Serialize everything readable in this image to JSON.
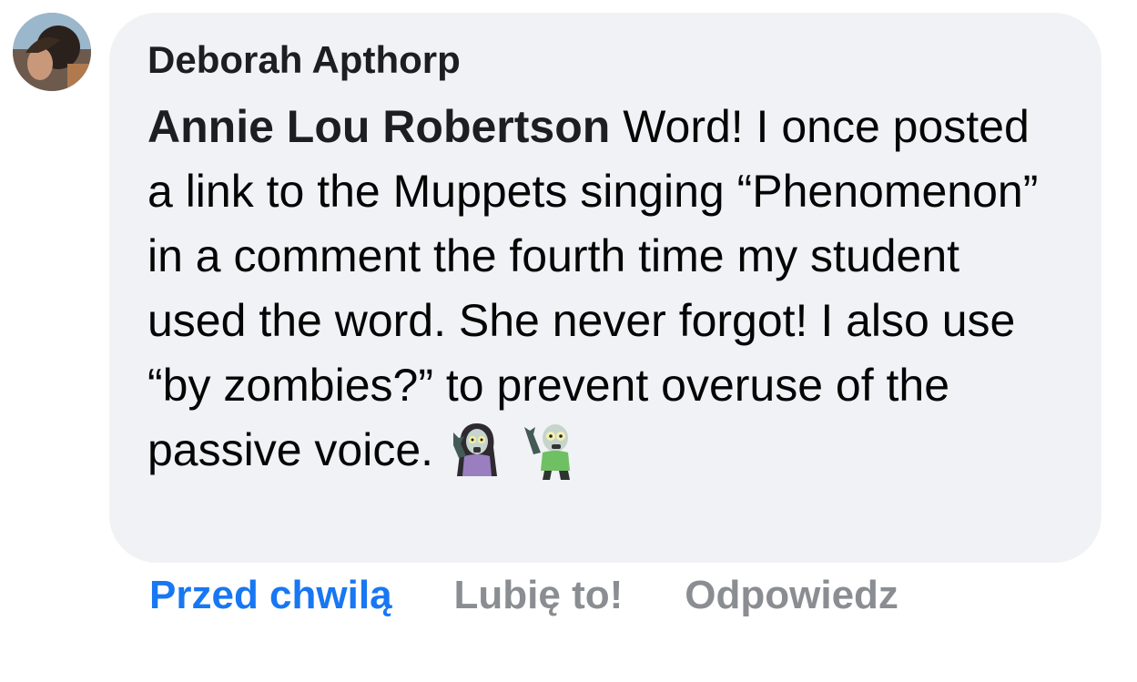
{
  "comment": {
    "author": "Deborah Apthorp",
    "mention": "Annie Lou Robertson",
    "text": "Word! I once posted a link to the Muppets singing “Phenomenon” in a comment the fourth time my student used the word. She never forgot! I also use “by zombies?” to prevent overuse of the passive voice.",
    "emojis": [
      "female-zombie-icon",
      "male-zombie-icon"
    ]
  },
  "actions": {
    "timestamp": "Przed chwilą",
    "like": "Lubię to!",
    "reply": "Odpowiedz"
  },
  "colors": {
    "bubble": "#f0f2f5",
    "timestamp": "#1877f2",
    "action": "#8a8d91",
    "text": "#050505"
  }
}
